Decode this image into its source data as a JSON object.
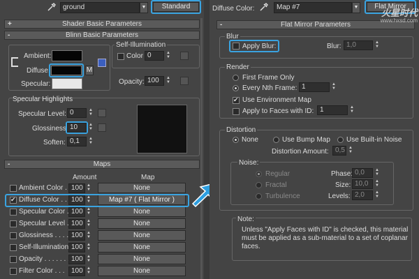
{
  "left": {
    "material_name": "ground",
    "material_type": "Standard",
    "shader_rollout": "Shader Basic Parameters",
    "blinn_rollout": "Blinn Basic Parameters",
    "ambient_label": "Ambient:",
    "diffuse_label": "Diffuse:",
    "specular_label": "Specular:",
    "m_button": "M",
    "self_illum_title": "Self-Illumination",
    "color_label": "Color",
    "color_value": "0",
    "opacity_label": "Opacity:",
    "opacity_value": "100",
    "spec_highlights_title": "Specular Highlights",
    "spec_level_label": "Specular Level:",
    "spec_level_value": "0",
    "glossiness_label": "Glossiness:",
    "glossiness_value": "10",
    "soften_label": "Soften:",
    "soften_value": "0,1",
    "maps_rollout": "Maps",
    "amount_header": "Amount",
    "map_header": "Map",
    "maps": [
      {
        "name": "Ambient Color . .",
        "amount": "100",
        "map": "None",
        "checked": false
      },
      {
        "name": "Diffuse Color . . .",
        "amount": "100",
        "map": "Map #7  ( Flat Mirror )",
        "checked": true
      },
      {
        "name": "Specular Color .",
        "amount": "100",
        "map": "None",
        "checked": false
      },
      {
        "name": "Specular Level .",
        "amount": "100",
        "map": "None",
        "checked": false
      },
      {
        "name": "Glossiness . . . . .",
        "amount": "100",
        "map": "None",
        "checked": false
      },
      {
        "name": "Self-Illumination .",
        "amount": "100",
        "map": "None",
        "checked": false
      },
      {
        "name": "Opacity . . . . . . .",
        "amount": "100",
        "map": "None",
        "checked": false
      },
      {
        "name": "Filter Color . . .",
        "amount": "100",
        "map": "None",
        "checked": false
      }
    ]
  },
  "right": {
    "diffuse_color_label": "Diffuse Color:",
    "map_name": "Map #7",
    "map_type": "Flat Mirror",
    "rollout_title": "Flat Mirror Parameters",
    "blur_title": "Blur",
    "apply_blur_label": "Apply Blur:",
    "blur_label": "Blur:",
    "blur_value": "1,0",
    "render_title": "Render",
    "first_frame_label": "First Frame Only",
    "every_nth_label": "Every Nth Frame:",
    "every_nth_value": "1",
    "use_env_map_label": "Use Environment Map",
    "apply_faces_label": "Apply to Faces with ID:",
    "apply_faces_value": "1",
    "distortion_title": "Distortion",
    "dist_none_label": "None",
    "dist_bump_label": "Use Bump Map",
    "dist_builtin_label": "Use Built-in Noise",
    "distortion_amount_label": "Distortion Amount:",
    "distortion_amount_value": "0,5",
    "noise_title": "Noise:",
    "regular_label": "Regular",
    "fractal_label": "Fractal",
    "turbulence_label": "Turbulence",
    "phase_label": "Phase:",
    "phase_value": "0,0",
    "size_label": "Size:",
    "size_value": "10,0",
    "levels_label": "Levels:",
    "levels_value": "2,0",
    "note_title": "Note:",
    "note_text": "Unless \"Apply Faces with ID\" is checked, this material must be applied as a sub-material to a set of coplanar faces."
  },
  "watermark": {
    "logo_text": "火星时代",
    "url": "www.hxsd.com"
  },
  "colors": {
    "highlight": "#3aa3e0",
    "arrow": "#2e9fe0",
    "panel": "#444444"
  }
}
